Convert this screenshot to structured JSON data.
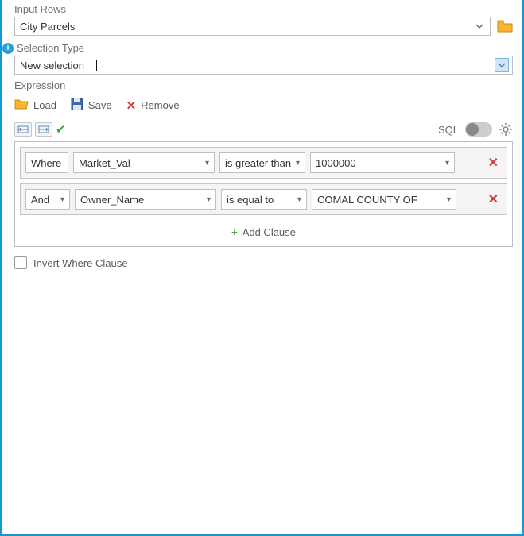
{
  "inputRows": {
    "label": "Input Rows",
    "value": "City Parcels"
  },
  "selectionType": {
    "label": "Selection Type",
    "value": "New selection"
  },
  "expression": {
    "label": "Expression",
    "toolbar": {
      "load": "Load",
      "save": "Save",
      "remove": "Remove"
    },
    "sqlLabel": "SQL",
    "clauses": [
      {
        "prefix": "Where",
        "field": "Market_Val",
        "operator": "is greater than",
        "value": "1000000"
      },
      {
        "conjunction": "And",
        "field": "Owner_Name",
        "operator": "is equal to",
        "value": "COMAL COUNTY OF"
      }
    ],
    "addClause": "Add Clause"
  },
  "invert": {
    "label": "Invert Where Clause",
    "checked": false
  }
}
